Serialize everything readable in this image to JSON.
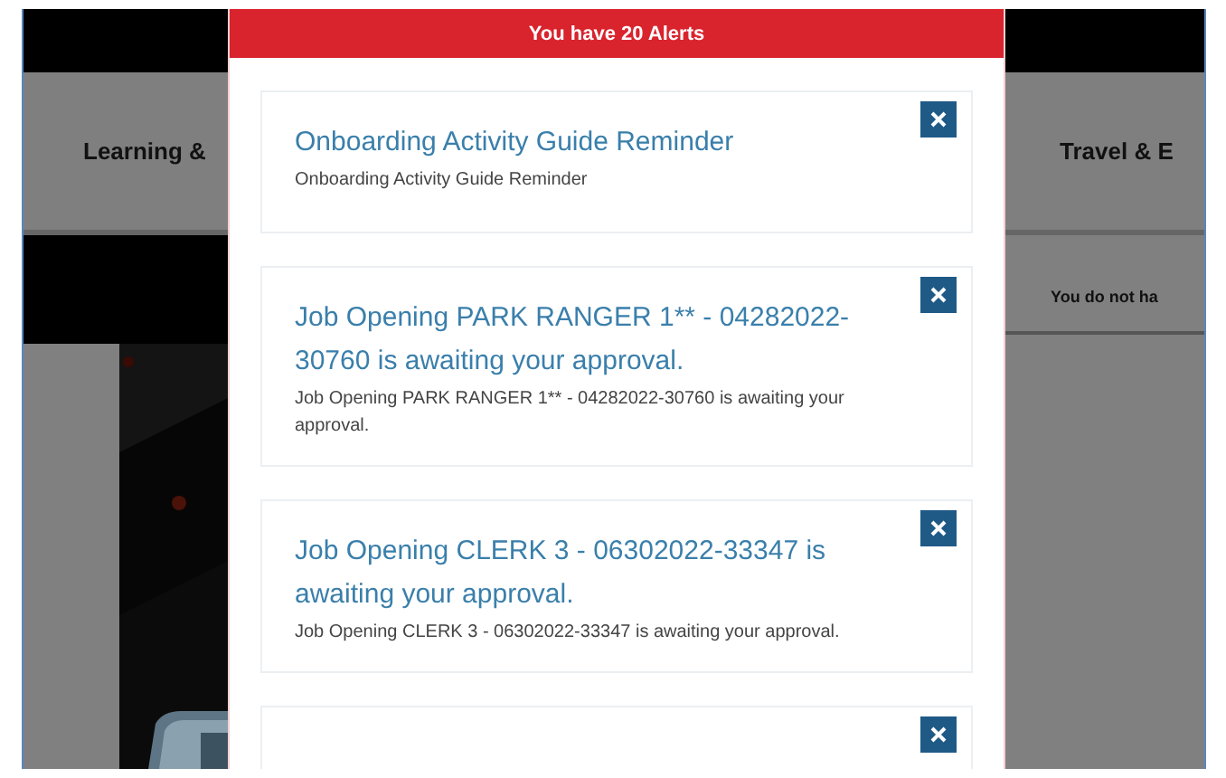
{
  "nav": {
    "left_label": "Learning &",
    "right_label": "Travel & E"
  },
  "right_panel": {
    "text": "You do not ha"
  },
  "modal": {
    "title": "You have 20 Alerts",
    "alerts": [
      {
        "title": "Onboarding Activity Guide Reminder",
        "body": "Onboarding Activity Guide Reminder"
      },
      {
        "title": "Job Opening PARK RANGER 1** - 04282022-30760 is awaiting your approval.",
        "body": "Job Opening PARK RANGER 1** - 04282022-30760 is awaiting your approval."
      },
      {
        "title": "Job Opening CLERK 3 - 06302022-33347 is awaiting your approval.",
        "body": "Job Opening CLERK 3 - 06302022-33347 is awaiting your approval."
      }
    ],
    "more_below": true
  }
}
